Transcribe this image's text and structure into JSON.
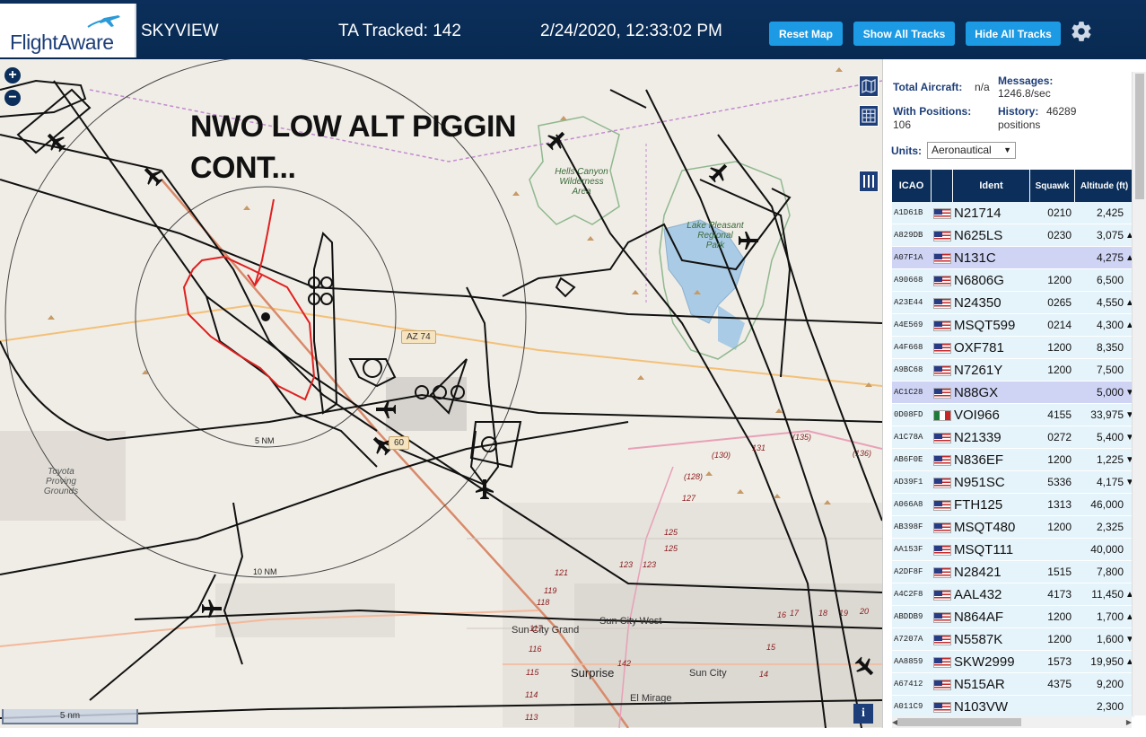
{
  "header": {
    "logo_text": "FlightAware",
    "site_name": "SKYVIEW",
    "tracked": "TA Tracked: 142",
    "datetime": "2/24/2020, 12:33:02 PM",
    "buttons": {
      "reset": "Reset Map",
      "show": "Show All Tracks",
      "hide": "Hide All Tracks"
    }
  },
  "map": {
    "annotation_line1": "NWO LOW ALT PIGGIN",
    "annotation_line2": "CONT...",
    "ring_labels": {
      "inner": "5 NM",
      "outer": "10 NM"
    },
    "scale_label": "5 nm",
    "road_badges": {
      "az74": "AZ 74",
      "us60": "60"
    },
    "park1": "Hells Canyon\nWilderness\nArea",
    "park2": "Lake Pleasant\nRegional\nPark",
    "toyota": "Toyota\nProving\nGrounds",
    "cities": {
      "sun_city_grand": "Sun City Grand",
      "sun_city_west": "Sun City West",
      "surprise": "Surprise",
      "sun_city": "Sun City",
      "el_mirage": "El Mirage"
    },
    "route_numbers": [
      "(130)",
      "131",
      "(135)",
      "(136)",
      "(128)",
      "127",
      "125",
      "125",
      "123",
      "123",
      "121",
      "119",
      "118",
      "117",
      "116",
      "115",
      "114",
      "113",
      "142",
      "17",
      "16",
      "18",
      "19",
      "20",
      "14",
      "15"
    ],
    "info_label": "i"
  },
  "stats": {
    "total_label": "Total Aircraft:",
    "total_value": "n/a",
    "messages_label": "Messages:",
    "messages_value": "1246.8/sec",
    "positions_label": "With Positions:",
    "positions_value": "106",
    "history_label": "History:",
    "history_value": "46289",
    "history_unit": "positions"
  },
  "units": {
    "label": "Units:",
    "selected": "Aeronautical"
  },
  "table": {
    "headers": {
      "icao": "ICAO",
      "ident": "Ident",
      "squawk": "Squawk",
      "altitude": "Altitude (ft)"
    },
    "rows": [
      {
        "icao": "A1D61B",
        "flag": "us",
        "ident": "N21714",
        "squawk": "0210",
        "alt": "2,425",
        "trend": ""
      },
      {
        "icao": "A829DB",
        "flag": "us",
        "ident": "N625LS",
        "squawk": "0230",
        "alt": "3,075",
        "trend": "▲"
      },
      {
        "icao": "A07F1A",
        "flag": "us",
        "ident": "N131C",
        "squawk": "",
        "alt": "4,275",
        "trend": "▲",
        "selected": true
      },
      {
        "icao": "A90668",
        "flag": "us",
        "ident": "N6806G",
        "squawk": "1200",
        "alt": "6,500",
        "trend": ""
      },
      {
        "icao": "A23E44",
        "flag": "us",
        "ident": "N24350",
        "squawk": "0265",
        "alt": "4,550",
        "trend": "▲"
      },
      {
        "icao": "A4E569",
        "flag": "us",
        "ident": "MSQT599",
        "squawk": "0214",
        "alt": "4,300",
        "trend": "▲"
      },
      {
        "icao": "A4F668",
        "flag": "us",
        "ident": "OXF781",
        "squawk": "1200",
        "alt": "8,350",
        "trend": ""
      },
      {
        "icao": "A9BC68",
        "flag": "us",
        "ident": "N7261Y",
        "squawk": "1200",
        "alt": "7,500",
        "trend": ""
      },
      {
        "icao": "AC1C28",
        "flag": "us",
        "ident": "N88GX",
        "squawk": "",
        "alt": "5,000",
        "trend": "▼",
        "selected": true
      },
      {
        "icao": "0D08FD",
        "flag": "mx",
        "ident": "VOI966",
        "squawk": "4155",
        "alt": "33,975",
        "trend": "▼"
      },
      {
        "icao": "A1C78A",
        "flag": "us",
        "ident": "N21339",
        "squawk": "0272",
        "alt": "5,400",
        "trend": "▼"
      },
      {
        "icao": "AB6F0E",
        "flag": "us",
        "ident": "N836EF",
        "squawk": "1200",
        "alt": "1,225",
        "trend": "▼"
      },
      {
        "icao": "AD39F1",
        "flag": "us",
        "ident": "N951SC",
        "squawk": "5336",
        "alt": "4,175",
        "trend": "▼"
      },
      {
        "icao": "A066A8",
        "flag": "us",
        "ident": "FTH125",
        "squawk": "1313",
        "alt": "46,000",
        "trend": ""
      },
      {
        "icao": "AB398F",
        "flag": "us",
        "ident": "MSQT480",
        "squawk": "1200",
        "alt": "2,325",
        "trend": ""
      },
      {
        "icao": "AA153F",
        "flag": "us",
        "ident": "MSQT111",
        "squawk": "",
        "alt": "40,000",
        "trend": ""
      },
      {
        "icao": "A2DF8F",
        "flag": "us",
        "ident": "N28421",
        "squawk": "1515",
        "alt": "7,800",
        "trend": ""
      },
      {
        "icao": "A4C2F8",
        "flag": "us",
        "ident": "AAL432",
        "squawk": "4173",
        "alt": "11,450",
        "trend": "▲"
      },
      {
        "icao": "ABDDB9",
        "flag": "us",
        "ident": "N864AF",
        "squawk": "1200",
        "alt": "1,700",
        "trend": "▲"
      },
      {
        "icao": "A7207A",
        "flag": "us",
        "ident": "N5587K",
        "squawk": "1200",
        "alt": "1,600",
        "trend": "▼"
      },
      {
        "icao": "AA8859",
        "flag": "us",
        "ident": "SKW2999",
        "squawk": "1573",
        "alt": "19,950",
        "trend": "▲"
      },
      {
        "icao": "A67412",
        "flag": "us",
        "ident": "N515AR",
        "squawk": "4375",
        "alt": "9,200",
        "trend": ""
      },
      {
        "icao": "A011C9",
        "flag": "us",
        "ident": "N103VW",
        "squawk": "",
        "alt": "2,300",
        "trend": ""
      }
    ]
  },
  "colors": {
    "header_bg": "#0b2f5a",
    "button": "#1c9be4",
    "selected_row": "#cfd4f5",
    "row": "#e5f3fa",
    "annotation": "#e02020"
  }
}
